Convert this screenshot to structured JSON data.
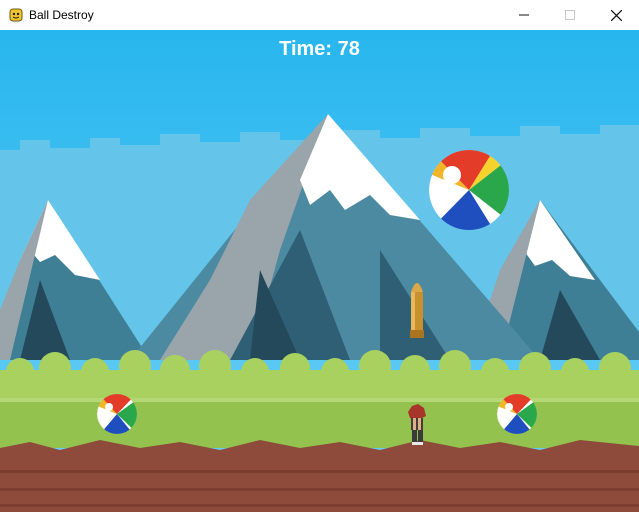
{
  "window": {
    "title": "Ball Destroy",
    "app_icon": "pygame-snake-icon",
    "controls": [
      "minimize-icon",
      "maximize-icon",
      "close-icon"
    ]
  },
  "hud": {
    "time_label": "Time: 78"
  },
  "colors": {
    "sky": "#2bb8ee",
    "mountain_dark": "#2e5f74",
    "mountain_mid": "#4b8aa0",
    "snow": "#ffffff",
    "grass": "#93c24f",
    "bush": "#a8d160",
    "dirt": "#8e4a3a",
    "hud_text": "#ffffff"
  },
  "scene": {
    "balls": [
      "beach-ball",
      "beach-ball",
      "beach-ball"
    ],
    "projectile": "bullet",
    "player": "player-character"
  }
}
